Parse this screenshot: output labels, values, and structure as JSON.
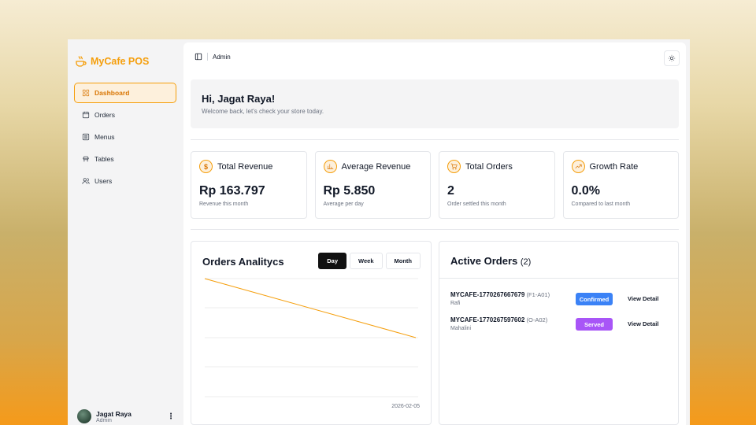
{
  "brand": {
    "name": "MyCafe POS",
    "color": "#f59e0b"
  },
  "sidebar": {
    "items": [
      {
        "label": "Dashboard",
        "icon": "dashboard-icon",
        "active": true
      },
      {
        "label": "Orders",
        "icon": "orders-icon"
      },
      {
        "label": "Menus",
        "icon": "menus-icon"
      },
      {
        "label": "Tables",
        "icon": "tables-icon"
      },
      {
        "label": "Users",
        "icon": "users-icon"
      }
    ],
    "user": {
      "name": "Jagat Raya",
      "role": "Admin"
    }
  },
  "topbar": {
    "breadcrumb": "Admin"
  },
  "welcome": {
    "title": "Hi, Jagat Raya!",
    "subtitle": "Welcome back, let's check your store today."
  },
  "stats": [
    {
      "title": "Total Revenue",
      "value": "Rp 163.797",
      "sub": "Revenue this month",
      "icon": "dollar-icon"
    },
    {
      "title": "Average Revenue",
      "value": "Rp 5.850",
      "sub": "Average per day",
      "icon": "bar-chart-icon"
    },
    {
      "title": "Total Orders",
      "value": "2",
      "sub": "Order settled this month",
      "icon": "cart-icon"
    },
    {
      "title": "Growth Rate",
      "value": "0.0%",
      "sub": "Compared to last month",
      "icon": "trending-up-icon"
    }
  ],
  "chart": {
    "title": "Orders Analitycs",
    "ranges": [
      "Day",
      "Week",
      "Month"
    ],
    "active_range": "Day",
    "x_label": "2026-02-05",
    "line_color": "#f59e0b"
  },
  "active_orders": {
    "title": "Active Orders",
    "count": "(2)",
    "orders": [
      {
        "id": "MYCAFE-1770267667679",
        "table": "(F1-A01)",
        "customer": "Rafi",
        "status": "Confirmed",
        "status_color": "#3b82f6",
        "action": "View Detail"
      },
      {
        "id": "MYCAFE-1770267597602",
        "table": "(O-A02)",
        "customer": "Mahalini",
        "status": "Served",
        "status_color": "#a855f7",
        "action": "View Detail"
      }
    ]
  }
}
